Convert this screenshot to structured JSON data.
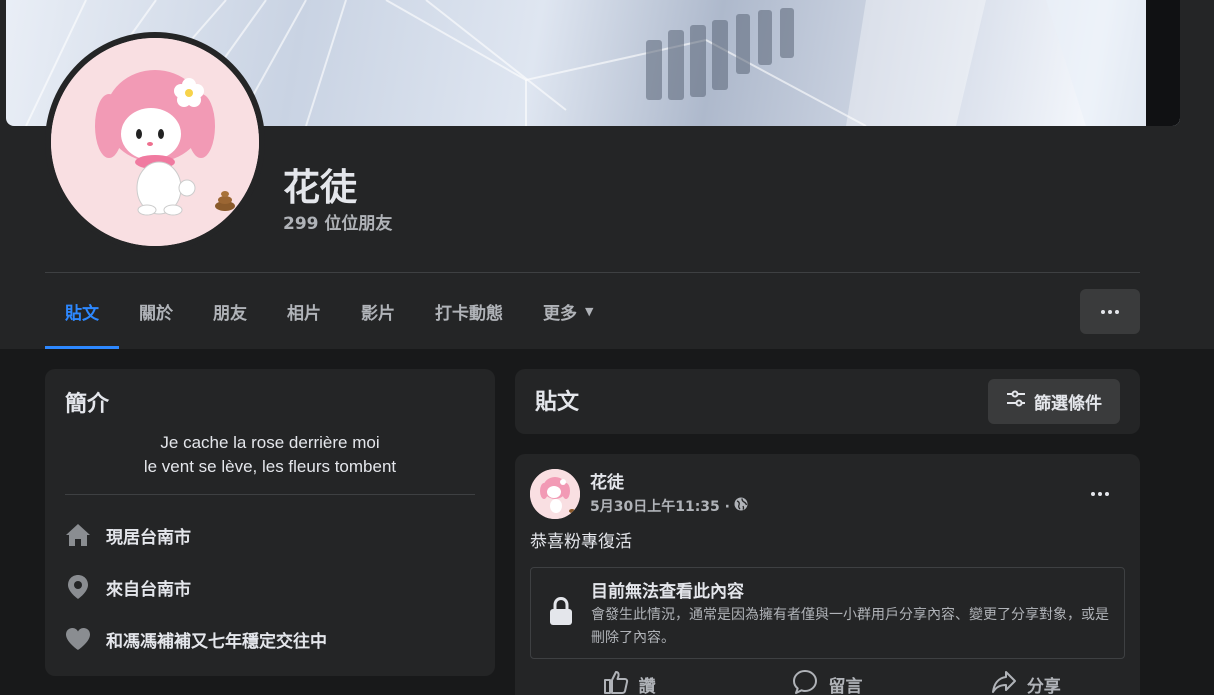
{
  "profile": {
    "name": "花徒",
    "friends": "299 位位朋友"
  },
  "tabs": [
    {
      "label": "貼文",
      "active": true
    },
    {
      "label": "關於"
    },
    {
      "label": "朋友"
    },
    {
      "label": "相片"
    },
    {
      "label": "影片"
    },
    {
      "label": "打卡動態"
    },
    {
      "label": "更多"
    }
  ],
  "intro": {
    "title": "簡介",
    "bio_line1": "Je cache la rose derrière moi",
    "bio_line2": "le vent se lève, les fleurs tombent",
    "items": [
      {
        "icon": "home-icon",
        "text": "現居台南市"
      },
      {
        "icon": "location-pin-icon",
        "text": "來自台南市"
      },
      {
        "icon": "heart-icon",
        "text": "和馮馮補補又七年穩定交往中"
      }
    ]
  },
  "posts": {
    "title": "貼文",
    "filter_label": "篩選條件"
  },
  "post": {
    "author": "花徒",
    "timestamp": "5月30日上午11:35 ·",
    "privacy_icon": "globe-icon",
    "text": "恭喜粉專復活",
    "unavailable_title": "目前無法查看此內容",
    "unavailable_desc": "會發生此情況，通常是因為擁有者僅與一小群用戶分享內容、變更了分享對象，或是刪除了內容。",
    "actions": {
      "like": "讚",
      "comment": "留言",
      "share": "分享"
    }
  },
  "colors": {
    "accent": "#2d88ff",
    "background": "#18191a",
    "card": "#242526"
  }
}
